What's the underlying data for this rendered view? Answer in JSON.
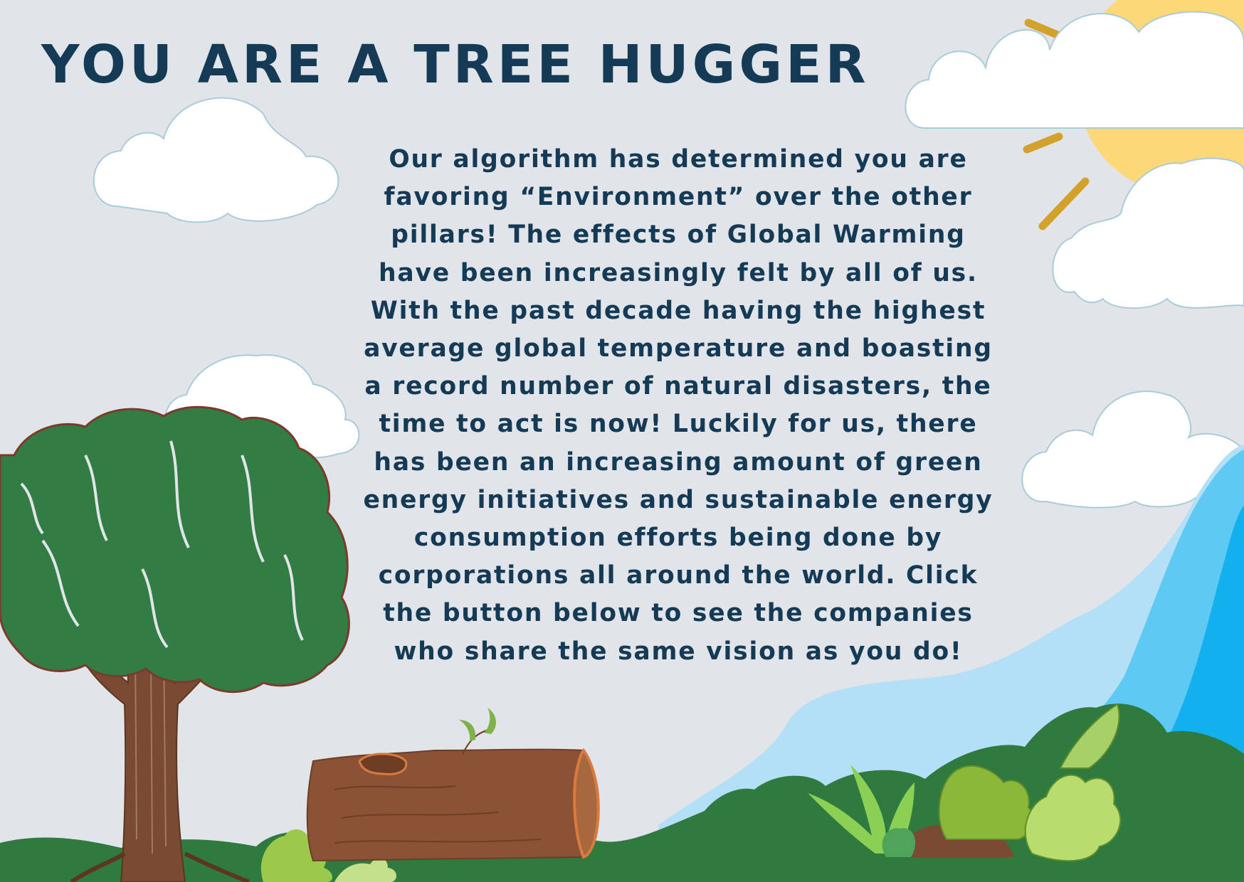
{
  "title": "YOU ARE A TREE HUGGER",
  "body": "Our algorithm has determined you are favoring “Environment” over the other pillars! The effects of Global Warming have been increasingly felt by all of us. With the past decade having the highest average global temperature and boasting a record number of natural disasters, the time to act is now! Luckily for us, there has been an increasing amount of green energy initiatives and sustainable energy consumption efforts being done by corporations all around the world. Click the button below to see the companies who share the same vision as you do!",
  "colors": {
    "background": "#e1e4e8",
    "text": "#143a56",
    "sun": "#fdd878",
    "sun_rays": "#d2a22c",
    "tree_foliage": "#327d43",
    "tree_trunk": "#7a4a33",
    "log": "#8c5236",
    "grass": "#2f7a3e",
    "water_light": "#b3e0f7",
    "water_mid": "#5ec9f2",
    "water_dark": "#12b1ee"
  },
  "icons": [
    "sun-icon",
    "cloud-icon",
    "tree-icon",
    "log-icon",
    "plant-icon",
    "river-icon"
  ]
}
